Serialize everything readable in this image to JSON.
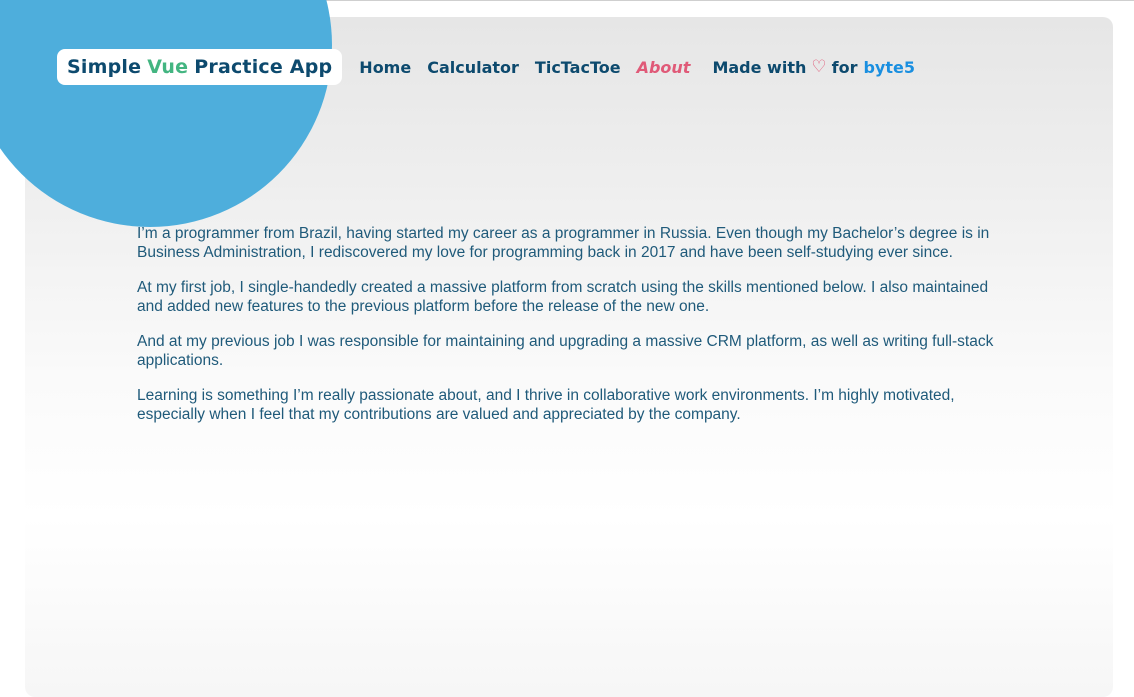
{
  "header": {
    "logo": {
      "prefix": "Simple",
      "accent": "Vue",
      "suffix": "Practice App"
    },
    "nav": [
      {
        "label": "Home",
        "active": false
      },
      {
        "label": "Calculator",
        "active": false
      },
      {
        "label": "TicTacToe",
        "active": false
      },
      {
        "label": "About",
        "active": true
      }
    ],
    "made_with": {
      "prefix": "Made with",
      "icon": "heart-icon",
      "middle": "for",
      "link": "byte5"
    }
  },
  "colors": {
    "primary": "#0d4a6e",
    "accent_green": "#43b581",
    "active_pink": "#e05a78",
    "link_blue": "#1a8fe0",
    "blob_blue": "#4eaedc",
    "body_text": "#1f5a7a"
  },
  "about": {
    "paragraphs": [
      "I’m a programmer from Brazil, having started my career as a programmer in Russia. Even though my Bachelor’s degree is in Business Administration, I rediscovered my love for programming back in 2017 and have been self-studying ever since.",
      "At my first job, I single-handedly created a massive platform from scratch using the skills mentioned below. I also maintained and added new features to the previous platform before the release of the new one.",
      "And at my previous job I was responsible for maintaining and upgrading a massive CRM platform, as well as writing full-stack applications.",
      "Learning is something I’m really passionate about, and I thrive in collaborative work environments. I’m highly motivated, especially when I feel that my contributions are valued and appreciated by the company."
    ]
  }
}
